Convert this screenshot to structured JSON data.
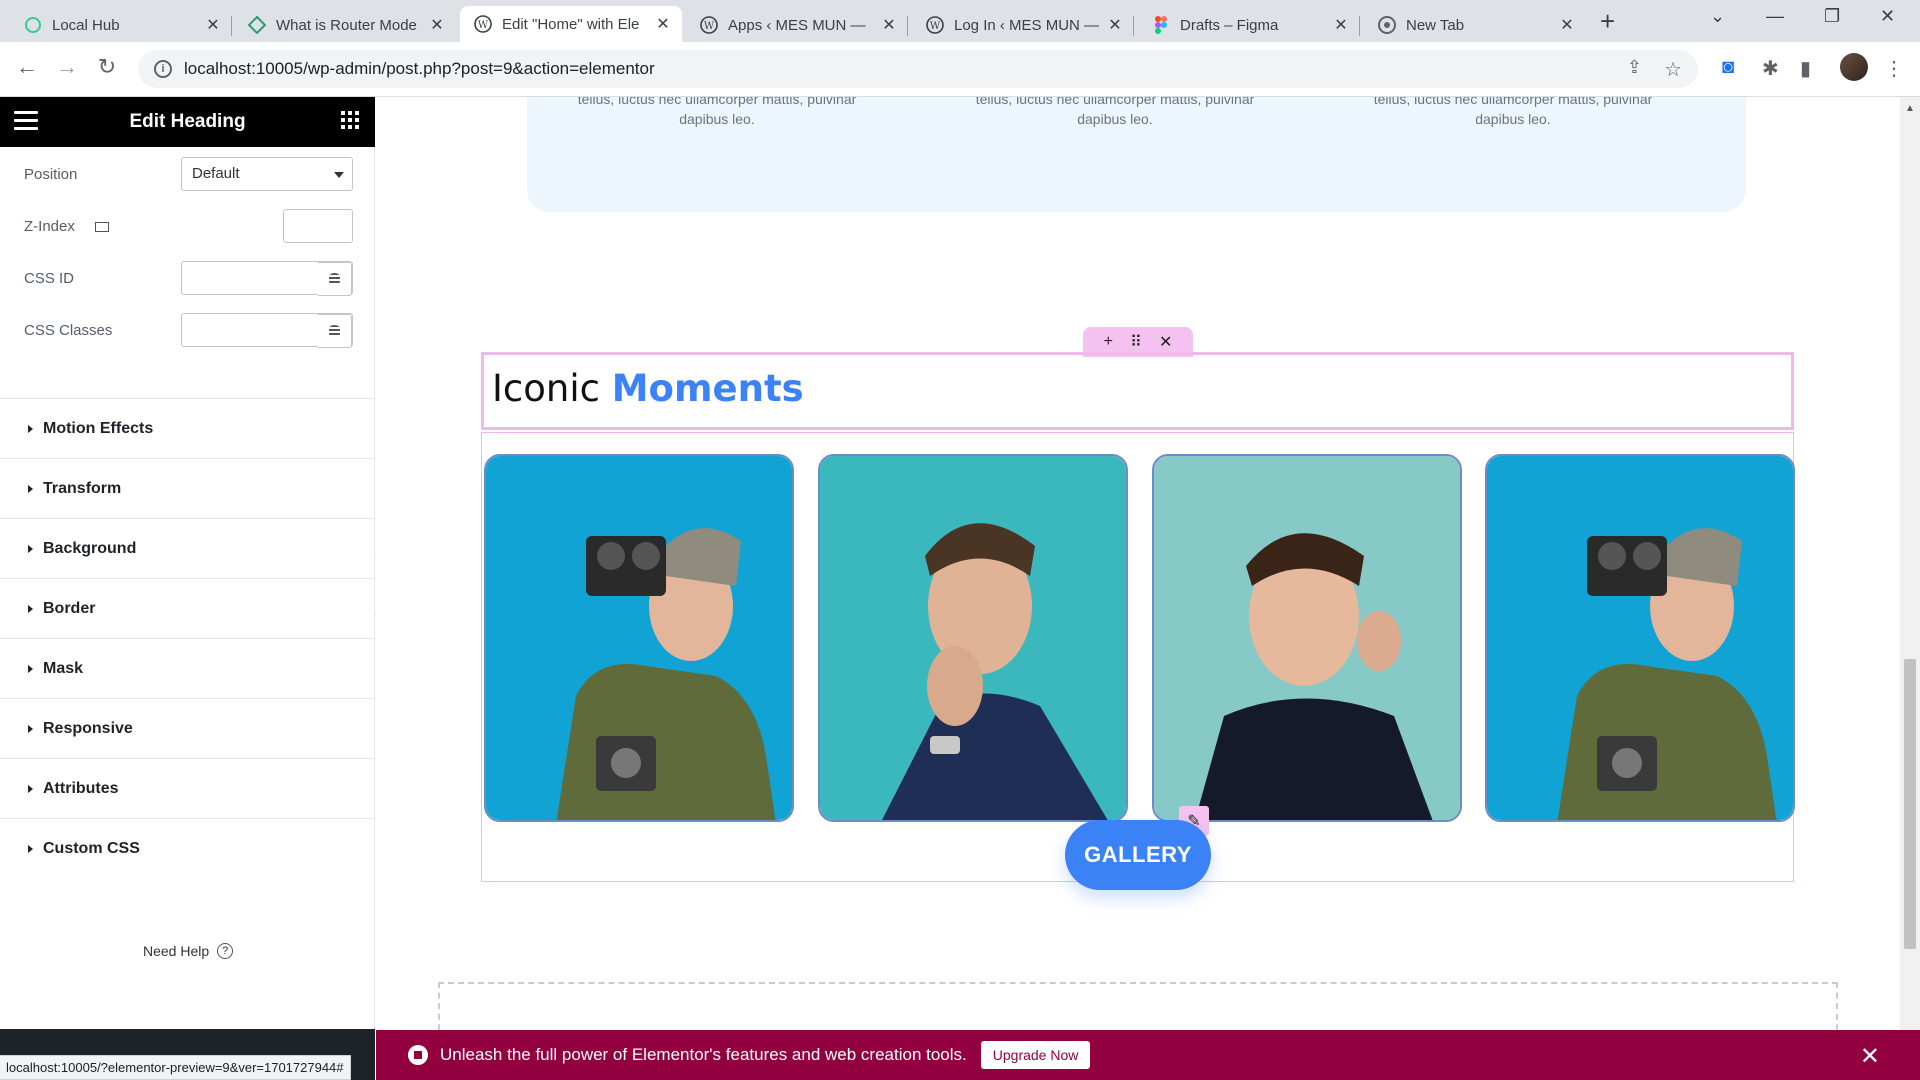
{
  "browser": {
    "tabs": [
      {
        "title": "Local Hub",
        "icon": "local-icon"
      },
      {
        "title": "What is Router Mode",
        "icon": "router-icon"
      },
      {
        "title": "Edit \"Home\" with Ele",
        "icon": "wordpress-icon"
      },
      {
        "title": "Apps ‹ MES MUN —",
        "icon": "wordpress-icon"
      },
      {
        "title": "Log In ‹ MES MUN —",
        "icon": "wordpress-icon"
      },
      {
        "title": "Drafts – Figma",
        "icon": "figma-icon"
      },
      {
        "title": "New Tab",
        "icon": "chrome-icon"
      }
    ],
    "url": "localhost:10005/wp-admin/post.php?post=9&action=elementor"
  },
  "panel": {
    "title": "Edit Heading",
    "fields": {
      "position_label": "Position",
      "position_value": "Default",
      "zindex_label": "Z-Index",
      "cssid_label": "CSS ID",
      "cssclasses_label": "CSS Classes"
    },
    "sections": [
      "Motion Effects",
      "Transform",
      "Background",
      "Border",
      "Mask",
      "Responsive",
      "Attributes",
      "Custom CSS"
    ],
    "need_help": "Need Help"
  },
  "canvas": {
    "top_texts": [
      "tellus, luctus nec ullamcorper mattis, pulvinar dapibus leo.",
      "tellus, luctus nec ullamcorper mattis, pulvinar dapibus leo.",
      "tellus, luctus nec ullamcorper mattis, pulvinar dapibus leo."
    ],
    "heading_plain": "Iconic ",
    "heading_highlight": "Moments",
    "gallery_button": "GALLERY",
    "photos": [
      "photographer-camera",
      "man-thinking",
      "man-smiling",
      "photographer-camera"
    ]
  },
  "promo": {
    "text": "Unleash the full power of Elementor's features and web creation tools.",
    "button": "Upgrade Now"
  },
  "status_url": "localhost:10005/?elementor-preview=9&ver=1701727944#",
  "colors": {
    "accent": "#3b82f6",
    "promo_bg": "#93003f",
    "selection": "#f0b6ee"
  }
}
